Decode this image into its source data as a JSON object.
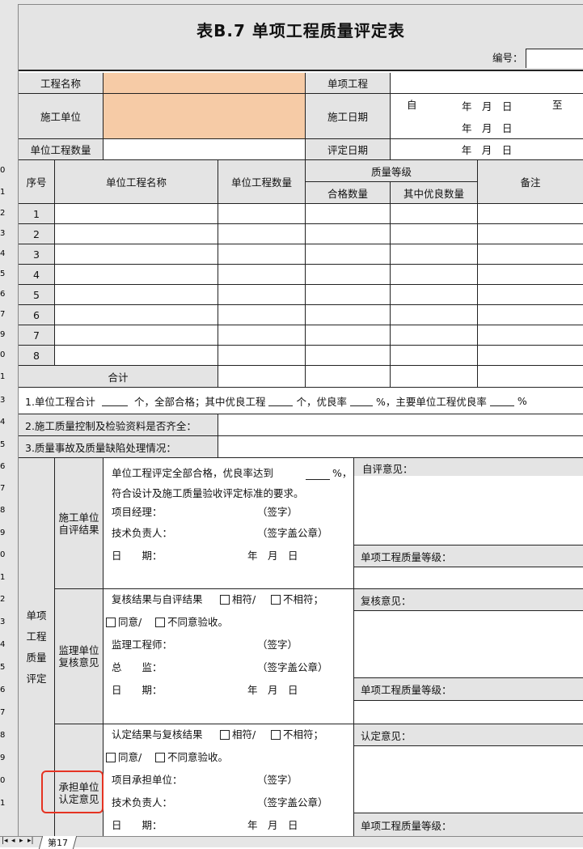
{
  "title": "表B.7 单项工程质量评定表",
  "code_label": "编号：",
  "row_numbers": [
    "0",
    "1",
    "2",
    "3",
    "4",
    "5",
    "6",
    "7",
    "9",
    "0",
    "1",
    "3",
    "4",
    "5",
    "6",
    "7",
    "8",
    "9",
    "0",
    "1",
    "2",
    "3",
    "4",
    "5",
    "6",
    "7",
    "8",
    "9",
    "0",
    "1"
  ],
  "header": {
    "project_name": "工程名称",
    "single_project": "单项工程",
    "contractor": "施工单位",
    "construction_date": "施工日期",
    "from": "自",
    "to": "至",
    "ymd": "年　月　日",
    "unit_count": "单位工程数量",
    "eval_date": "评定日期"
  },
  "table": {
    "col_no": "序号",
    "col_name": "单位工程名称",
    "col_count": "单位工程数量",
    "col_grade": "质量等级",
    "col_pass": "合格数量",
    "col_excellent": "其中优良数量",
    "col_note": "备注",
    "rows": [
      "1",
      "2",
      "3",
      "4",
      "5",
      "6",
      "7",
      "8"
    ],
    "total": "合计"
  },
  "summary": {
    "line1_a": "1.单位工程合计",
    "line1_b": "个，全部合格；其中优良工程",
    "line1_c": "个，优良率",
    "line1_d": "%，主要单位工程优良率",
    "line1_e": "%",
    "line2": "2.施工质量控制及检验资料是否齐全：",
    "line3": "3.质量事故及质量缺陷处理情况："
  },
  "evaluation": {
    "side_label": [
      "单项",
      "工程",
      "质量",
      "评定"
    ],
    "self": {
      "label": [
        "施工单位",
        "自评结果"
      ],
      "text1": "单位工程评定全部合格，优良率达到",
      "pct": "%，",
      "text2": "符合设计及施工质量验收评定标准的要求。",
      "pm": "项目经理：",
      "tech": "技术负责人：",
      "sign": "（签字）",
      "seal": "（签字盖公章）",
      "date": "日　　期：",
      "ymd": "年　月　日",
      "opinion": "自评意见：",
      "grade": "单项工程质量等级："
    },
    "review": {
      "label": [
        "监理单位",
        "复核意见"
      ],
      "text1": "复核结果与自评结果",
      "match": "相符/",
      "nomatch": "不相符；",
      "agree": "同意/",
      "disagree": "不同意验收。",
      "engineer": "监理工程师：",
      "chief": "总　　监：",
      "sign": "（签字）",
      "seal": "（签字盖公章）",
      "date": "日　　期：",
      "ymd": "年　月　日",
      "opinion": "复核意见：",
      "grade": "单项工程质量等级："
    },
    "confirm": {
      "label": [
        "承担单位",
        "认定意见"
      ],
      "text1": "认定结果与复核结果",
      "match": "相符/",
      "nomatch": "不相符；",
      "agree": "同意/",
      "disagree": "不同意验收。",
      "unit": "项目承担单位：",
      "tech": "技术负责人：",
      "sign": "（签字）",
      "seal": "（签字盖公章）",
      "date": "日　　期：",
      "ymd": "年　月　日",
      "opinion": "认定意见：",
      "grade": "单项工程质量等级："
    }
  },
  "sheet_tab": "第17",
  "highlight_color": "#e53322"
}
